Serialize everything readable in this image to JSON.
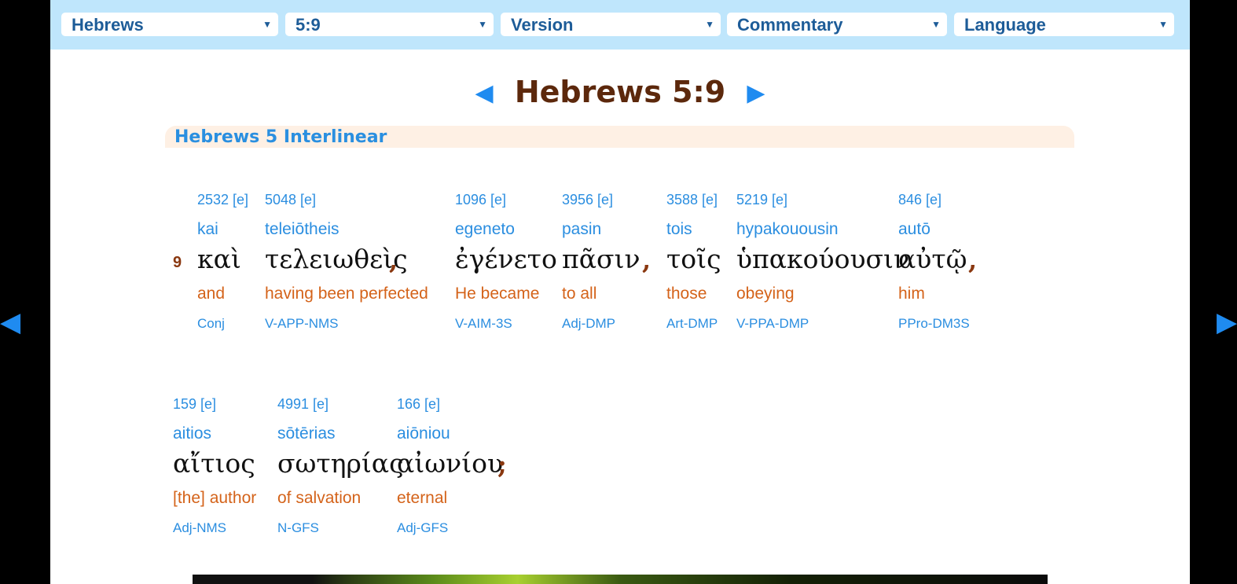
{
  "toolbar": {
    "book": "Hebrews",
    "chapter_verse": "5:9",
    "version": "Version",
    "commentary": "Commentary",
    "language": "Language",
    "dropdown_arrow": "▼"
  },
  "nav": {
    "prev_glyph": "◀",
    "next_glyph": "▶",
    "title": "Hebrews 5:9"
  },
  "section": {
    "heading": "Hebrews 5 Interlinear"
  },
  "verse": {
    "number": "9",
    "words": [
      {
        "strong": "2532 [e]",
        "translit": "kai",
        "greek": "καὶ",
        "english": "and",
        "parse": "Conj"
      },
      {
        "strong": "5048 [e]",
        "translit": "teleiōtheis",
        "greek": "τελειωθεὶς",
        "english": "having been perfected",
        "parse": "V-APP-NMS"
      },
      {
        "strong": "1096 [e]",
        "translit": "egeneto",
        "greek": "ἐγένετο",
        "english": "He became",
        "parse": "V-AIM-3S"
      },
      {
        "strong": "3956 [e]",
        "translit": "pasin",
        "greek": "πᾶσιν",
        "english": "to all",
        "parse": "Adj-DMP"
      },
      {
        "strong": "3588 [e]",
        "translit": "tois",
        "greek": "τοῖς",
        "english": "those",
        "parse": "Art-DMP"
      },
      {
        "strong": "5219 [e]",
        "translit": "hypakouousin",
        "greek": "ὑπακούουσιν",
        "english": "obeying",
        "parse": "V-PPA-DMP"
      },
      {
        "strong": "846 [e]",
        "translit": "autō",
        "greek": "αὐτῷ",
        "english": "him",
        "parse": "PPro-DM3S"
      },
      {
        "strong": "159 [e]",
        "translit": "aitios",
        "greek": "αἴτιος",
        "english": "[the] author",
        "parse": "Adj-NMS"
      },
      {
        "strong": "4991 [e]",
        "translit": "sōtērias",
        "greek": "σωτηρίας",
        "english": "of salvation",
        "parse": "N-GFS"
      },
      {
        "strong": "166 [e]",
        "translit": "aiōniou",
        "greek": "αἰωνίου",
        "english": "eternal",
        "parse": "Adj-GFS"
      }
    ],
    "punctuation": [
      ",",
      ",",
      ",",
      ";"
    ]
  },
  "side_nav": {
    "left_glyph": "◀",
    "right_glyph": "▶"
  }
}
